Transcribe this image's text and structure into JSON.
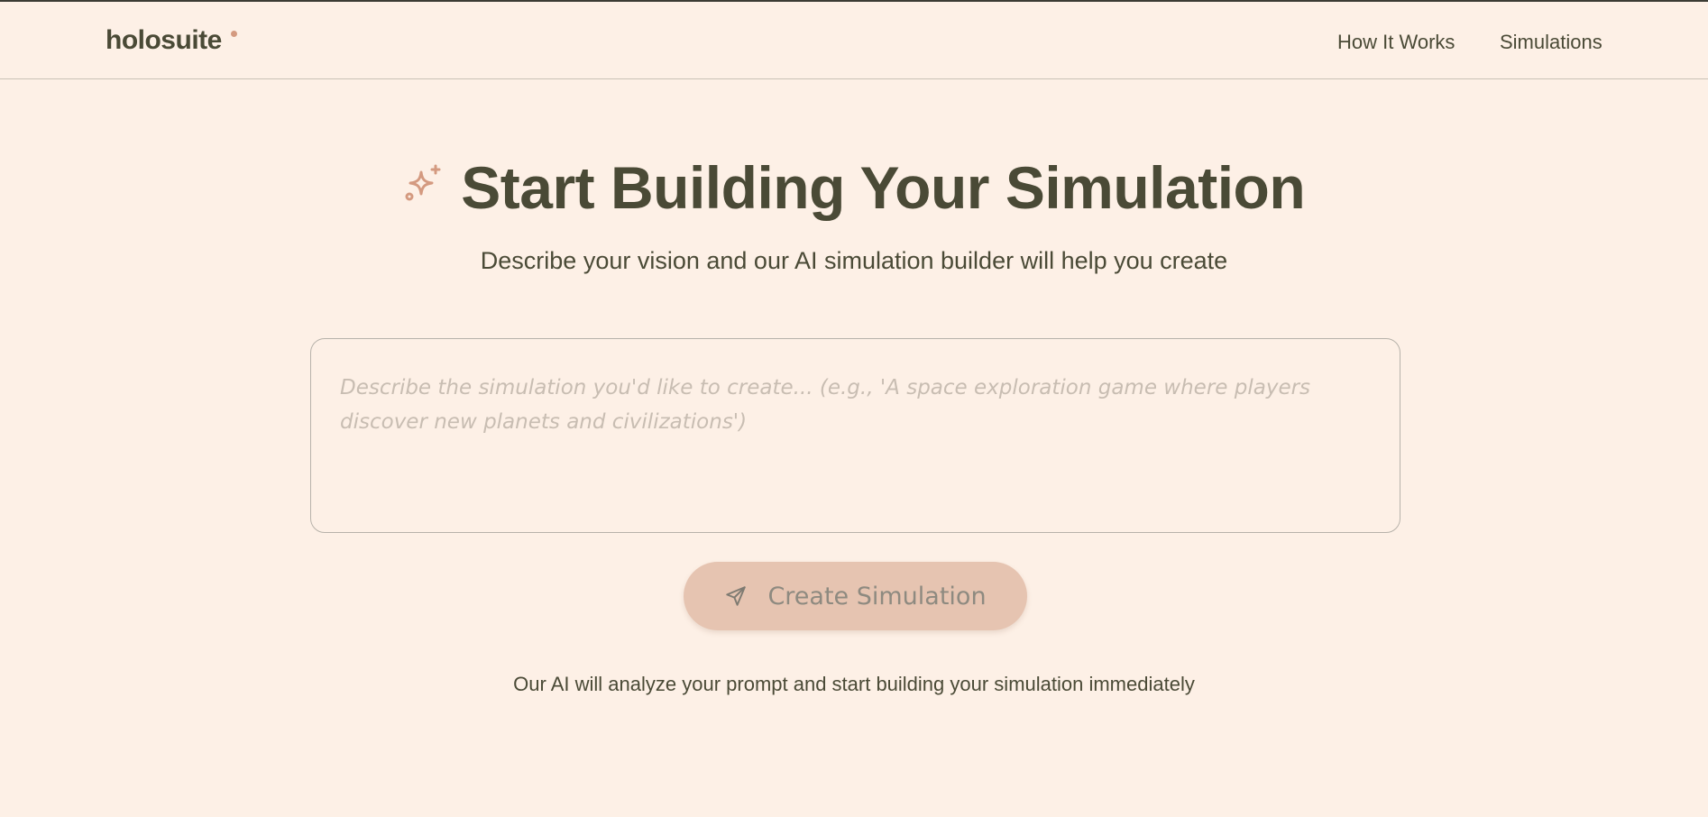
{
  "header": {
    "logo_text": "holosuite",
    "nav": [
      {
        "label": "How It Works"
      },
      {
        "label": "Simulations"
      }
    ]
  },
  "hero": {
    "title": "Start Building Your Simulation",
    "subtitle": "Describe your vision and our AI simulation builder will help you create",
    "icon": "sparkles-icon"
  },
  "prompt": {
    "value": "",
    "placeholder": "Describe the simulation you'd like to create... (e.g., 'A space exploration game where players discover new planets and civilizations')"
  },
  "create_button": {
    "label": "Create Simulation",
    "icon": "send-icon",
    "enabled": false
  },
  "footnote": "Our AI will analyze your prompt and start building your simulation immediately",
  "colors": {
    "background": "#fdf0e6",
    "text": "#4a4a36",
    "accent": "#d49a80",
    "button": "#e6c4b1",
    "button_text": "#8e8a80"
  }
}
